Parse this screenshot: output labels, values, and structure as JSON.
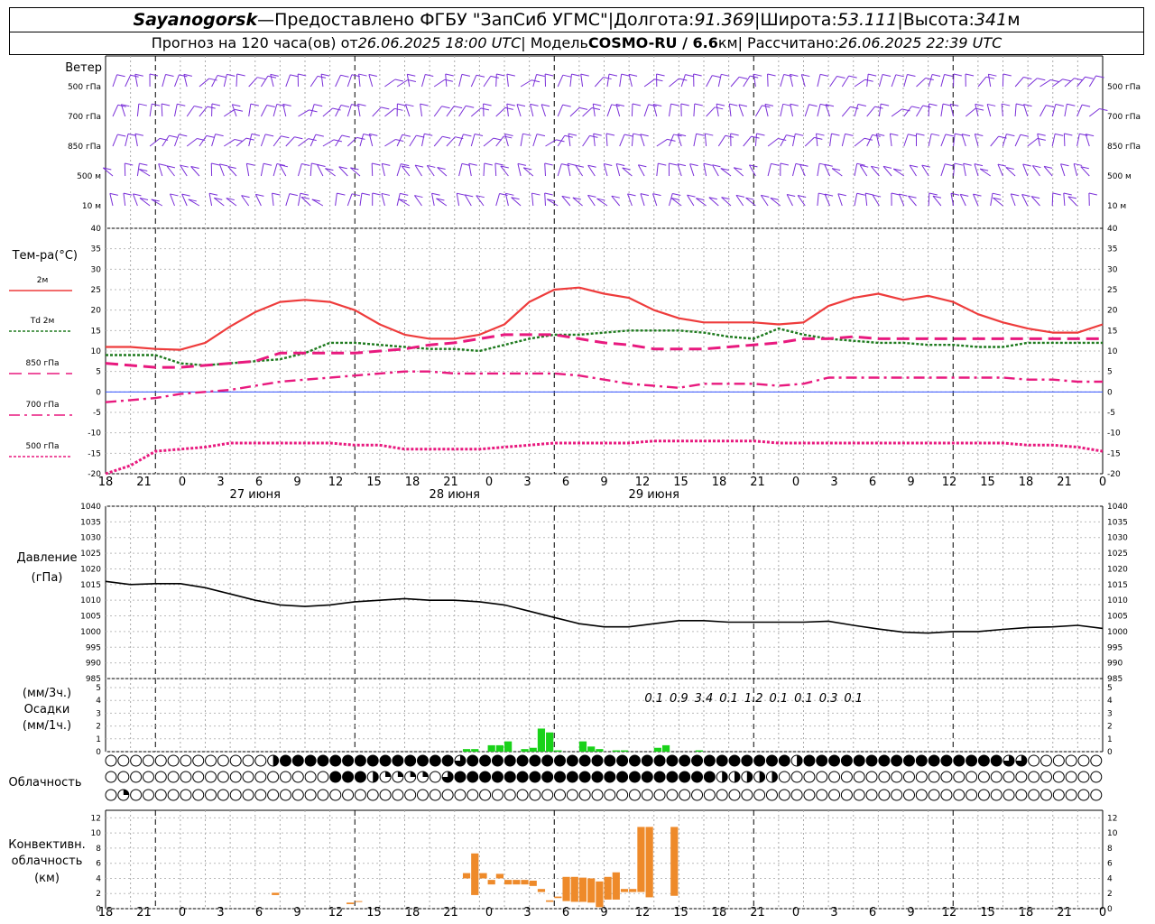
{
  "header": {
    "line1": {
      "location": "Sayanogorsk",
      "dash": " — ",
      "provider": "Предоставлено ФГБУ \"ЗапСиб УГМС\"",
      "sep": " | ",
      "lon_label": "Долгота: ",
      "lon_value": "91.369",
      "lat_label": "Широта: ",
      "lat_value": "53.111",
      "alt_label": "Высота: ",
      "alt_value": "341",
      "alt_unit": "м"
    },
    "line2": {
      "forecast_label": "Прогноз на 120 часа(ов) от ",
      "forecast_date": "26.06.2025 18:00 UTC",
      "model_label": "  | Модель ",
      "model_name": "COSMO-RU / 6.6",
      "model_unit": "км",
      "calc_label": " | Рассчитано: ",
      "calc_date": "26.06.2025 22:39 UTC"
    }
  },
  "time_axis": {
    "hour_labels": [
      "18",
      "21",
      "0",
      "3",
      "6",
      "9",
      "12",
      "15",
      "18",
      "21",
      "0",
      "3",
      "6",
      "9",
      "12",
      "15",
      "18",
      "21",
      "0",
      "3",
      "6",
      "9",
      "12",
      "15",
      "18",
      "21",
      "0"
    ],
    "day_labels": [
      "27 июня",
      "28 июня",
      "29 июня"
    ]
  },
  "colors": {
    "wind": "#7a2fd8",
    "t2m": "#ee3c3c",
    "td2m": "#1e7a1e",
    "t850": "#e8197e",
    "t700": "#e8197e",
    "t500": "#e8197e",
    "pressure": "#000000",
    "precip": "#19d219",
    "convective": "#ee8a2a",
    "zero_line": "#3050ff"
  },
  "wind_panel": {
    "title": "Ветер",
    "levels": [
      "500 гПа",
      "700 гПа",
      "850 гПа",
      "500 м",
      "10  м"
    ]
  },
  "chart_data": [
    {
      "type": "line",
      "title": "Тем-ра(°C)",
      "x_hours_from_start": [
        0,
        3,
        6,
        9,
        12,
        15,
        18,
        21,
        24,
        27,
        30,
        33,
        36,
        39,
        42,
        45,
        48,
        51,
        54,
        57,
        60,
        63,
        66,
        69,
        72,
        75,
        78,
        81,
        84,
        87,
        90,
        93,
        96,
        99,
        102,
        105,
        108,
        111,
        114,
        117,
        120
      ],
      "ylim": [
        -20,
        40
      ],
      "yticks": [
        -20,
        -15,
        -10,
        -5,
        0,
        5,
        10,
        15,
        20,
        25,
        30,
        35,
        40
      ],
      "series": [
        {
          "name": "2м",
          "values": [
            11,
            11,
            10.5,
            10.3,
            12,
            16,
            19.5,
            22,
            22.5,
            22,
            20,
            16.5,
            14,
            13,
            13,
            14,
            16.5,
            22,
            25,
            25.5,
            24,
            23,
            20,
            18,
            17,
            17,
            17,
            16.5,
            17,
            21,
            23,
            24,
            22.5,
            23.5,
            22,
            19,
            17,
            15.5,
            14.5,
            14.5,
            16.5
          ]
        },
        {
          "name": "Td 2м",
          "values": [
            9,
            9,
            9,
            7,
            6.5,
            7,
            7.5,
            8,
            9.5,
            12,
            12,
            11.5,
            11,
            10.5,
            10.5,
            10,
            11.5,
            13,
            14,
            14,
            14.5,
            15,
            15,
            15,
            14.5,
            13.5,
            13,
            15.5,
            14,
            13,
            12.5,
            12,
            12,
            11.5,
            11.5,
            11,
            11,
            12,
            12,
            12,
            12
          ]
        },
        {
          "name": "850 гПа",
          "values": [
            7,
            6.5,
            6,
            6,
            6.5,
            7,
            7.5,
            9.5,
            9.5,
            9.5,
            9.5,
            10,
            10.5,
            11.5,
            12,
            13,
            14,
            14,
            14,
            13,
            12,
            11.5,
            10.5,
            10.5,
            10.5,
            11,
            11.5,
            12,
            13,
            13,
            13.5,
            13,
            13,
            13,
            13,
            13,
            13,
            13,
            13,
            13,
            13
          ]
        },
        {
          "name": "700 гПа",
          "values": [
            -2.5,
            -2,
            -1.5,
            -0.5,
            0,
            0.5,
            1.5,
            2.5,
            3,
            3.5,
            4,
            4.5,
            5,
            5,
            4.5,
            4.5,
            4.5,
            4.5,
            4.5,
            4,
            3,
            2,
            1.5,
            1,
            2,
            2,
            2,
            1.5,
            2,
            3.5,
            3.5,
            3.5,
            3.5,
            3.5,
            3.5,
            3.5,
            3.5,
            3,
            3,
            2.5,
            2.5
          ]
        },
        {
          "name": "500 гПа",
          "values": [
            -20,
            -18,
            -14.5,
            -14,
            -13.5,
            -12.5,
            -12.5,
            -12.5,
            -12.5,
            -12.5,
            -13,
            -13,
            -14,
            -14,
            -14,
            -14,
            -13.5,
            -13,
            -12.5,
            -12.5,
            -12.5,
            -12.5,
            -12,
            -12,
            -12,
            -12,
            -12,
            -12.5,
            -12.5,
            -12.5,
            -12.5,
            -12.5,
            -12.5,
            -12.5,
            -12.5,
            -12.5,
            -12.5,
            -13,
            -13,
            -13.5,
            -14.5
          ]
        }
      ]
    },
    {
      "type": "line",
      "title": "Давление",
      "unit": "(гПа)",
      "x_hours_from_start": [
        0,
        3,
        6,
        9,
        12,
        15,
        18,
        21,
        24,
        27,
        30,
        33,
        36,
        39,
        42,
        45,
        48,
        51,
        54,
        57,
        60,
        63,
        66,
        69,
        72,
        75,
        78,
        81,
        84,
        87,
        90,
        93,
        96,
        99,
        102,
        105,
        108,
        111,
        114,
        117,
        120
      ],
      "ylim": [
        985,
        1040
      ],
      "yticks": [
        985,
        990,
        995,
        1000,
        1005,
        1010,
        1015,
        1020,
        1025,
        1030,
        1035,
        1040
      ],
      "series": [
        {
          "name": "",
          "values": [
            1016,
            1015,
            1015.3,
            1015.3,
            1014,
            1012,
            1010,
            1008.5,
            1008,
            1008.5,
            1009.5,
            1010,
            1010.5,
            1010,
            1010,
            1009.5,
            1008.5,
            1006.5,
            1004.5,
            1002.5,
            1001.5,
            1001.5,
            1002.5,
            1003.5,
            1003.5,
            1003,
            1003,
            1003,
            1003,
            1003.3,
            1002,
            1000.8,
            999.8,
            999.5,
            1000,
            1000,
            1000.7,
            1001.3,
            1001.5,
            1002,
            1001
          ]
        }
      ]
    },
    {
      "type": "bar",
      "title": "Осадки",
      "units": [
        "(мм/3ч.)",
        "(мм/1ч.)"
      ],
      "ylim": [
        0,
        5
      ],
      "yticks": [
        0,
        1,
        2,
        3,
        4,
        5
      ],
      "labels_3h": [
        {
          "hour": 66,
          "value": "0.1"
        },
        {
          "hour": 69,
          "value": "0.9"
        },
        {
          "hour": 72,
          "value": "3.4"
        },
        {
          "hour": 75,
          "value": "0.1"
        },
        {
          "hour": 78,
          "value": "1.2"
        },
        {
          "hour": 81,
          "value": "0.1"
        },
        {
          "hour": 84,
          "value": "0.1"
        },
        {
          "hour": 87,
          "value": "0.3"
        },
        {
          "hour": 90,
          "value": "0.1"
        }
      ],
      "hourly": [
        {
          "hour": 43,
          "value": 0.2
        },
        {
          "hour": 44,
          "value": 0.2
        },
        {
          "hour": 46,
          "value": 0.5
        },
        {
          "hour": 47,
          "value": 0.5
        },
        {
          "hour": 48,
          "value": 0.8
        },
        {
          "hour": 50,
          "value": 0.2
        },
        {
          "hour": 51,
          "value": 0.3
        },
        {
          "hour": 52,
          "value": 1.8
        },
        {
          "hour": 53,
          "value": 1.5
        },
        {
          "hour": 54,
          "value": 0.1
        },
        {
          "hour": 57,
          "value": 0.8
        },
        {
          "hour": 58,
          "value": 0.4
        },
        {
          "hour": 59,
          "value": 0.2
        },
        {
          "hour": 61,
          "value": 0.1
        },
        {
          "hour": 62,
          "value": 0.1
        },
        {
          "hour": 66,
          "value": 0.3
        },
        {
          "hour": 67,
          "value": 0.5
        },
        {
          "hour": 71,
          "value": 0.1
        }
      ]
    },
    {
      "type": "bar",
      "title": "Конвективн. облачность",
      "unit": "(км)",
      "ylim": [
        0,
        13
      ],
      "yticks": [
        0,
        2,
        4,
        6,
        8,
        10,
        12
      ],
      "blocks": [
        {
          "hour": 20,
          "base": 1.8,
          "top": 2.1
        },
        {
          "hour": 29,
          "base": 0.6,
          "top": 0.8
        },
        {
          "hour": 30,
          "base": 0.9,
          "top": 1.0
        },
        {
          "hour": 43,
          "base": 4,
          "top": 4.7
        },
        {
          "hour": 44,
          "base": 1.8,
          "top": 7.3
        },
        {
          "hour": 45,
          "base": 4,
          "top": 4.7
        },
        {
          "hour": 46,
          "base": 3.2,
          "top": 3.8
        },
        {
          "hour": 47,
          "base": 4,
          "top": 4.6
        },
        {
          "hour": 48,
          "base": 3.2,
          "top": 3.8
        },
        {
          "hour": 49,
          "base": 3.2,
          "top": 3.8
        },
        {
          "hour": 50,
          "base": 3.2,
          "top": 3.8
        },
        {
          "hour": 51,
          "base": 3,
          "top": 3.7
        },
        {
          "hour": 52,
          "base": 2.2,
          "top": 2.6
        },
        {
          "hour": 53,
          "base": 0.9,
          "top": 1.1
        },
        {
          "hour": 54,
          "base": 1.4,
          "top": 1.6
        },
        {
          "hour": 55,
          "base": 1,
          "top": 4.2
        },
        {
          "hour": 56,
          "base": 0.9,
          "top": 4.2
        },
        {
          "hour": 57,
          "base": 0.9,
          "top": 4.1
        },
        {
          "hour": 58,
          "base": 0.8,
          "top": 4.0
        },
        {
          "hour": 59,
          "base": 0.2,
          "top": 3.6
        },
        {
          "hour": 60,
          "base": 1.2,
          "top": 4.2
        },
        {
          "hour": 61,
          "base": 1.2,
          "top": 4.8
        },
        {
          "hour": 62,
          "base": 2.2,
          "top": 2.6
        },
        {
          "hour": 63,
          "base": 2.2,
          "top": 2.6
        },
        {
          "hour": 64,
          "base": 2.2,
          "top": 10.8
        },
        {
          "hour": 65,
          "base": 1.5,
          "top": 10.8
        },
        {
          "hour": 68,
          "base": 1.7,
          "top": 10.8
        }
      ]
    }
  ],
  "cloud_panel": {
    "title": "Облачность",
    "rows": [
      "000000000000000000022444444444443444444444443444434444444444444444444444444444444444442344444444444444444444444403320000000002",
      "000000000000000000000000000444444212111101344444444444444444444444444444444412222222200000000000000000000000000000000000000000",
      "010000000000000000000000000000000000000000000000000000000000000000000000000000000000000000000000000000000000000000000000000000"
    ]
  }
}
